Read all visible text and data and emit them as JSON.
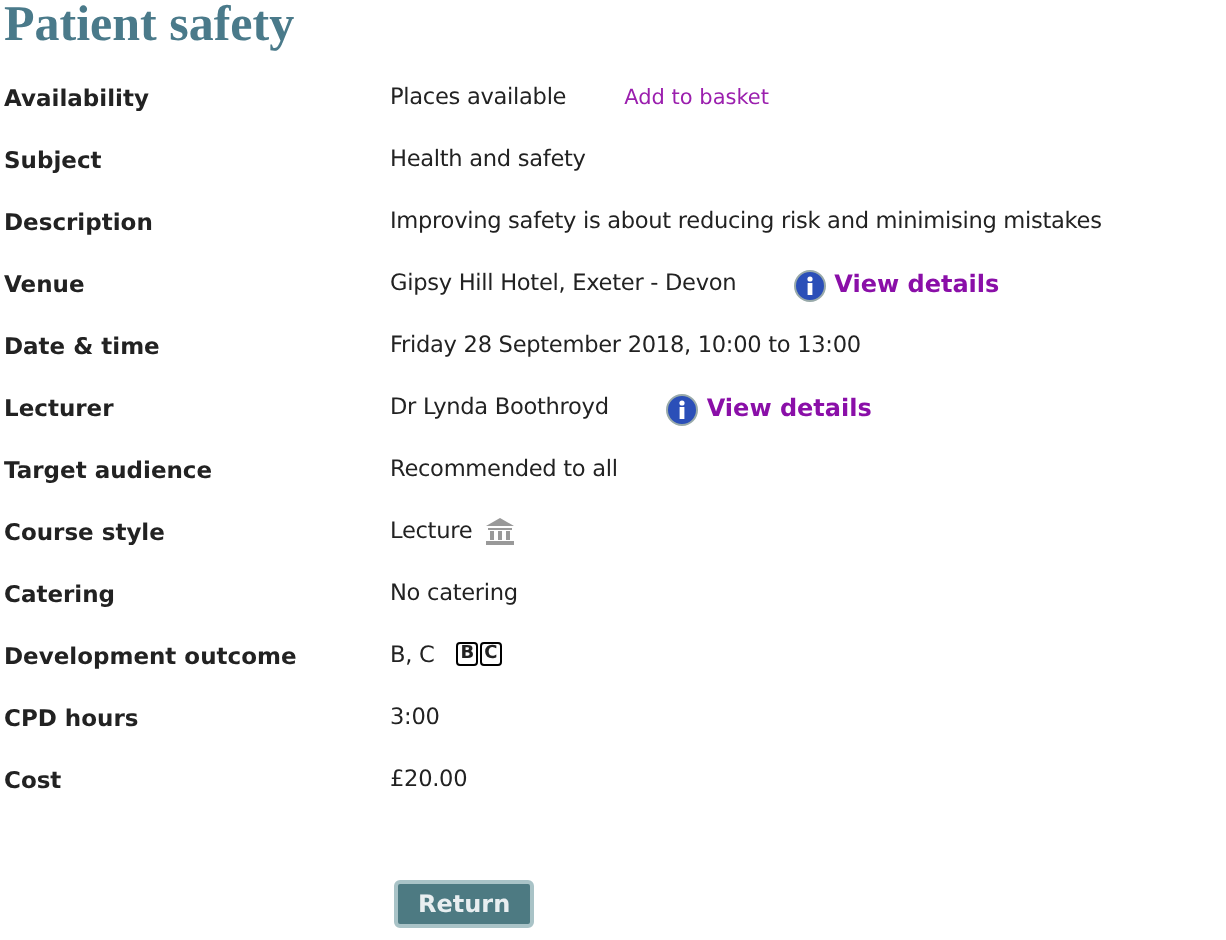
{
  "title": "Patient safety",
  "rows": [
    {
      "label": "Availability",
      "value": "Places available",
      "kind": "link",
      "link": "Add to basket"
    },
    {
      "label": "Subject",
      "value": "Health and safety",
      "kind": "plain"
    },
    {
      "label": "Description",
      "value": "Improving safety is about reducing risk and minimising mistakes",
      "kind": "plain"
    },
    {
      "label": "Venue",
      "value": "Gipsy Hill Hotel, Exeter - Devon",
      "kind": "details",
      "link": "View details"
    },
    {
      "label": "Date & time",
      "value": "Friday 28 September 2018, 10:00 to 13:00",
      "kind": "plain"
    },
    {
      "label": "Lecturer",
      "value": "Dr Lynda Boothroyd",
      "kind": "details",
      "link": "View details"
    },
    {
      "label": "Target audience",
      "value": "Recommended to all",
      "kind": "plain"
    },
    {
      "label": "Course style",
      "value": "Lecture",
      "kind": "icon"
    },
    {
      "label": "Catering",
      "value": "No catering",
      "kind": "plain"
    },
    {
      "label": "Development outcome",
      "value": "B, C",
      "kind": "badges",
      "badges": [
        "B",
        "C"
      ]
    },
    {
      "label": "CPD hours",
      "value": "3:00",
      "kind": "plain"
    },
    {
      "label": "Cost",
      "value": "£20.00",
      "kind": "plain"
    }
  ],
  "button": "Return"
}
